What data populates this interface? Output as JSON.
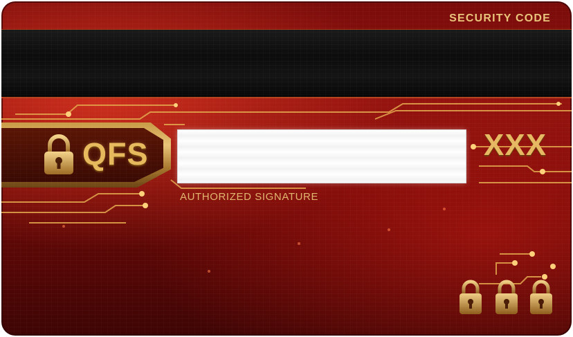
{
  "card": {
    "security_code_label": "SECURITY CODE",
    "brand": "QFS",
    "signature_label": "AUTHORIZED SIGNATURE",
    "security_code_value": "XXX"
  },
  "colors": {
    "card_red": "#8e120e",
    "gold": "#e7b95d",
    "stripe": "#0c0c0c",
    "signature_panel": "#ffffff"
  },
  "icons": [
    "lock-icon",
    "padlock-icon"
  ]
}
